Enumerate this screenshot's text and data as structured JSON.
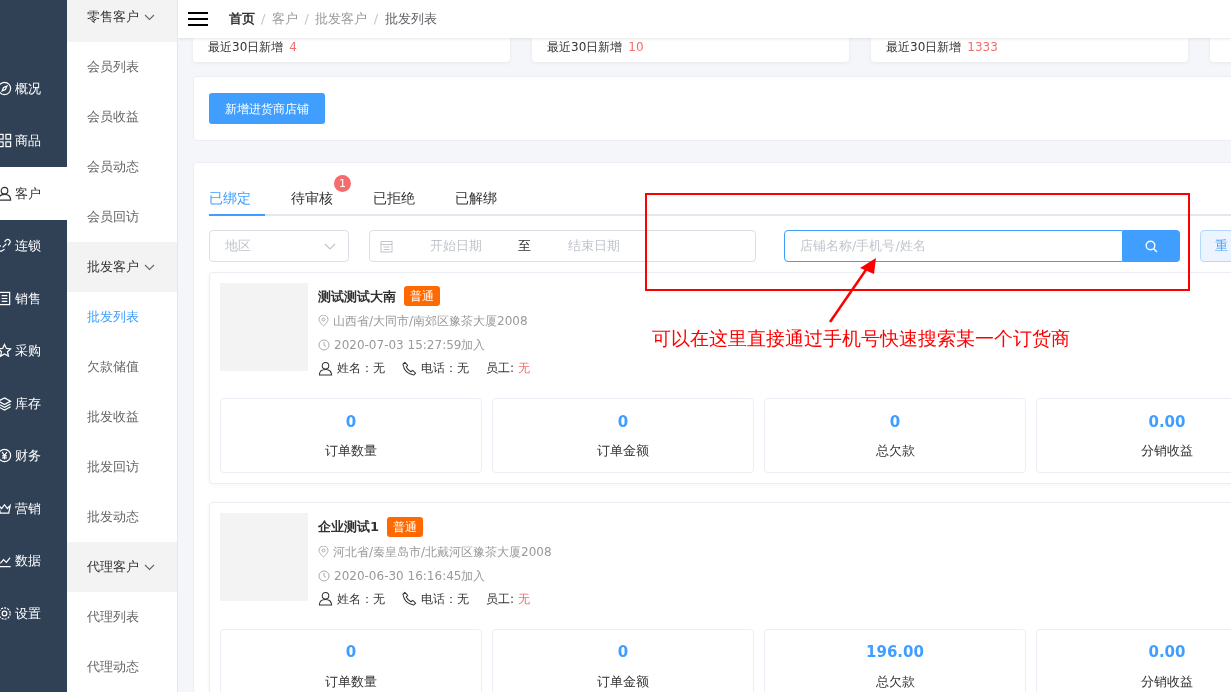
{
  "nav": [
    {
      "label": "概况",
      "selected": false
    },
    {
      "label": "商品",
      "selected": false
    },
    {
      "label": "客户",
      "selected": true
    },
    {
      "label": "连锁",
      "selected": false
    },
    {
      "label": "销售",
      "selected": false
    },
    {
      "label": "采购",
      "selected": false
    },
    {
      "label": "库存",
      "selected": false
    },
    {
      "label": "财务",
      "selected": false
    },
    {
      "label": "营销",
      "selected": false
    },
    {
      "label": "数据",
      "selected": false
    },
    {
      "label": "设置",
      "selected": false
    }
  ],
  "subnav": [
    {
      "kind": "group",
      "label": "零售客户"
    },
    {
      "kind": "item",
      "label": "会员列表",
      "selected": false
    },
    {
      "kind": "item",
      "label": "会员收益",
      "selected": false
    },
    {
      "kind": "item",
      "label": "会员动态",
      "selected": false
    },
    {
      "kind": "item",
      "label": "会员回访",
      "selected": false
    },
    {
      "kind": "group",
      "label": "批发客户"
    },
    {
      "kind": "item",
      "label": "批发列表",
      "selected": true
    },
    {
      "kind": "item",
      "label": "欠款储值",
      "selected": false
    },
    {
      "kind": "item",
      "label": "批发收益",
      "selected": false
    },
    {
      "kind": "item",
      "label": "批发回访",
      "selected": false
    },
    {
      "kind": "item",
      "label": "批发动态",
      "selected": false
    },
    {
      "kind": "group",
      "label": "代理客户"
    },
    {
      "kind": "item",
      "label": "代理列表",
      "selected": false
    },
    {
      "kind": "item",
      "label": "代理动态",
      "selected": false
    }
  ],
  "breadcrumb": [
    {
      "label": "首页"
    },
    {
      "separator": "/",
      "label": "客户"
    },
    {
      "separator": "/",
      "label": "批发客户"
    },
    {
      "separator": "/",
      "label": "批发列表"
    }
  ],
  "stats": [
    {
      "label": "最近30日新增",
      "value": "4"
    },
    {
      "label": "最近30日新增",
      "value": "10"
    },
    {
      "label": "最近30日新增",
      "value": "1333"
    }
  ],
  "add_button": "新增进货商店铺",
  "tabs": [
    {
      "label": "已绑定",
      "selected": true
    },
    {
      "label": "待审核",
      "selected": false,
      "badge": "1"
    },
    {
      "label": "已拒绝",
      "selected": false
    },
    {
      "label": "已解绑",
      "selected": false
    }
  ],
  "filters": {
    "region_placeholder": "地区",
    "start_placeholder": "开始日期",
    "separator": "至",
    "end_placeholder": "结束日期",
    "search_placeholder": "店铺名称/手机号/姓名",
    "reset_button": "重"
  },
  "stores": [
    {
      "name": "测试测试大南",
      "tag": "普通",
      "address": "山西省/大同市/南郊区豫茶大厦2008",
      "joined": "2020-07-03 15:27:59加入",
      "contact": "姓名：无",
      "phone": "电话：无",
      "staff_label": "员工:",
      "staff_value": "无",
      "metrics": [
        {
          "value": "0",
          "label": "订单数量"
        },
        {
          "value": "0",
          "label": "订单金额"
        },
        {
          "value": "0",
          "label": "总欠款"
        },
        {
          "value": "0.00",
          "label": "分销收益"
        }
      ]
    },
    {
      "name": "企业测试1",
      "tag": "普通",
      "address": "河北省/秦皇岛市/北戴河区豫茶大厦2008",
      "joined": "2020-06-30 16:16:45加入",
      "contact": "姓名：无",
      "phone": "电话：无",
      "staff_label": "员工:",
      "staff_value": "无",
      "metrics": [
        {
          "value": "0",
          "label": "订单数量"
        },
        {
          "value": "0",
          "label": "订单金额"
        },
        {
          "value": "196.00",
          "label": "总欠款"
        },
        {
          "value": "0.00",
          "label": "分销收益"
        }
      ]
    }
  ],
  "annotation": {
    "text": "可以在这里直接通过手机号快速搜索某一个订货商"
  }
}
